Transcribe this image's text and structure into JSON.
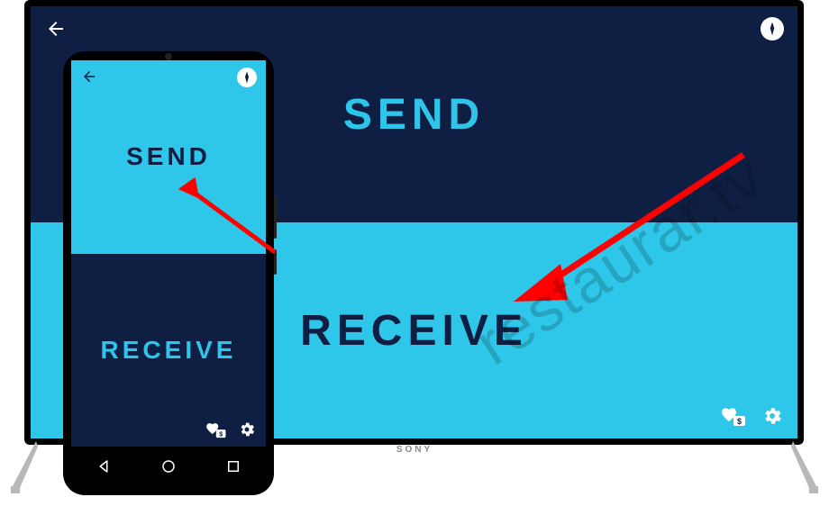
{
  "tv": {
    "send_label": "SEND",
    "receive_label": "RECEIVE",
    "brand": "SONY"
  },
  "phone": {
    "send_label": "SEND",
    "receive_label": "RECEIVE"
  },
  "watermark": "restaurar.tv",
  "icons": {
    "back": "back-arrow",
    "compass": "compass",
    "heart_badge": "heart-donate",
    "gear": "settings",
    "nav_back": "triangle-back",
    "nav_home": "circle-home",
    "nav_recent": "square-recent"
  },
  "colors": {
    "dark_navy": "#0f1f44",
    "cyan": "#2fc7e9",
    "accent_text": "#2fc4e9",
    "arrow": "#ff0000"
  }
}
